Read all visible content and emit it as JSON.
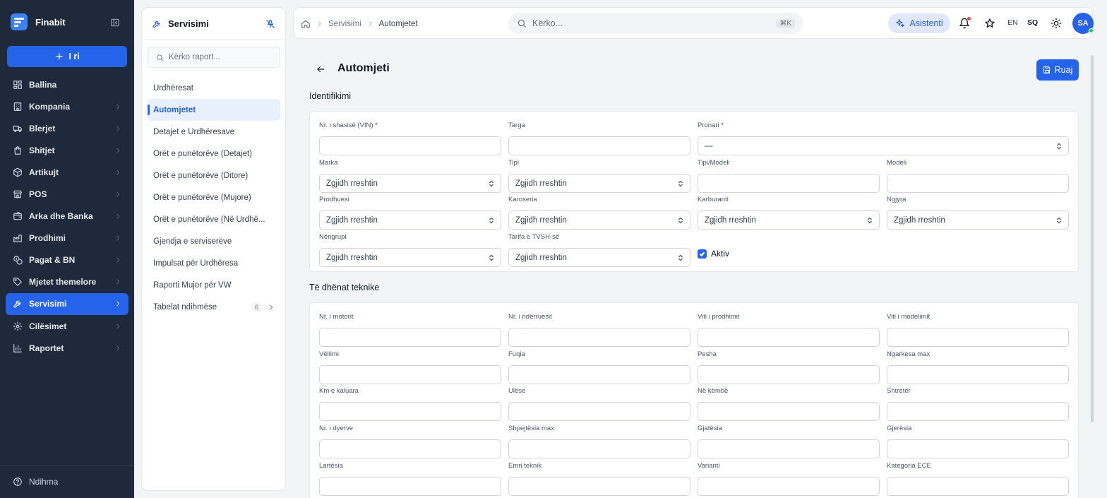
{
  "app": {
    "name": "Finabit",
    "new_label": "I ri",
    "help_label": "Ndihma"
  },
  "sidebar": {
    "items": [
      {
        "label": "Ballina",
        "icon": "dashboard-icon",
        "chevron": false
      },
      {
        "label": "Kompania",
        "icon": "building-icon",
        "chevron": true
      },
      {
        "label": "Blerjet",
        "icon": "truck-icon",
        "chevron": true
      },
      {
        "label": "Shitjet",
        "icon": "shopping-bag-icon",
        "chevron": true
      },
      {
        "label": "Artikujt",
        "icon": "box-icon",
        "chevron": true
      },
      {
        "label": "POS",
        "icon": "store-icon",
        "chevron": true
      },
      {
        "label": "Arka dhe Banka",
        "icon": "wallet-icon",
        "chevron": true
      },
      {
        "label": "Prodhimi",
        "icon": "factory-icon",
        "chevron": true
      },
      {
        "label": "Pagat & BN",
        "icon": "coins-icon",
        "chevron": true
      },
      {
        "label": "Mjetet themelore",
        "icon": "tag-icon",
        "chevron": true
      },
      {
        "label": "Servisimi",
        "icon": "wrench-icon",
        "chevron": true,
        "active": true
      },
      {
        "label": "Cilësimet",
        "icon": "gear-icon",
        "chevron": true
      },
      {
        "label": "Raportet",
        "icon": "bar-chart-icon",
        "chevron": true
      }
    ]
  },
  "subpanel": {
    "title": "Servisimi",
    "search_placeholder": "Kërko raport...",
    "items": [
      {
        "label": "Urdhëresat"
      },
      {
        "label": "Automjetet",
        "active": true
      },
      {
        "label": "Detajet e Urdhëresave"
      },
      {
        "label": "Orët e punëtorëve (Detajet)"
      },
      {
        "label": "Orët e punëtorëve (Ditore)"
      },
      {
        "label": "Orët e punëtorëve (Mujore)"
      },
      {
        "label": "Orët e punëtorëve (Në Urdhë..."
      },
      {
        "label": "Gjendja e serviserëve"
      },
      {
        "label": "Impulsat për Urdhëresa"
      },
      {
        "label": "Raporti Mujor për VW"
      },
      {
        "label": "Tabelat ndihmëse",
        "badge": "6",
        "chevron": true
      }
    ]
  },
  "topbar": {
    "breadcrumb": [
      "Servisimi",
      "Automjetet"
    ],
    "search_placeholder": "Kërko...",
    "search_shortcut": "⌘K",
    "assistant_label": "Asistenti",
    "lang_en": "EN",
    "lang_sq": "SQ",
    "avatar_initials": "SA"
  },
  "main": {
    "title": "Automjeti",
    "save_label": "Ruaj",
    "identification_title": "Identifikimi",
    "technical_title": "Të dhënat teknike",
    "select_placeholder": "Zgjidh rreshtin",
    "owner_value": "—",
    "active_label": "Aktiv",
    "active_checked": true,
    "identification_fields": [
      {
        "label": "Nr. i shasisë (VIN) *",
        "type": "input",
        "value": ""
      },
      {
        "label": "Targa",
        "type": "input",
        "value": ""
      },
      {
        "label": "Pronari *",
        "type": "select-owner",
        "value": "—"
      },
      {
        "label": "Marka",
        "type": "select"
      },
      {
        "label": "Tipi",
        "type": "select"
      },
      {
        "label": "Tipi/Modeli",
        "type": "input",
        "value": ""
      },
      {
        "label": "Modeli",
        "type": "input",
        "value": ""
      },
      {
        "label": "Prodhuesi",
        "type": "select"
      },
      {
        "label": "Karoseria",
        "type": "select"
      },
      {
        "label": "Karburanti",
        "type": "select"
      },
      {
        "label": "Ngjyra",
        "type": "select"
      },
      {
        "label": "Nëngrupi",
        "type": "select"
      },
      {
        "label": "Tarifa e TVSH-së",
        "type": "select"
      }
    ],
    "technical_fields": [
      "Nr. i motorit",
      "Nr. i ndërruesit",
      "Viti i prodhimit",
      "Viti i modelimit",
      "Vëllimi",
      "Fuqia",
      "Pesha",
      "Ngarkesa max",
      "Km e kaluara",
      "Ulëse",
      "Në këmbë",
      "Shtretër",
      "Nr. i dyerve",
      "Shpejtësia max",
      "Gjatësia",
      "Gjerësia",
      "Lartësia",
      "Emri teknik",
      "Varianti",
      "Kategoria ECE"
    ]
  },
  "colors": {
    "sidebar_bg": "#1e293b",
    "accent": "#2563eb",
    "page_bg": "#f3f4f6"
  }
}
